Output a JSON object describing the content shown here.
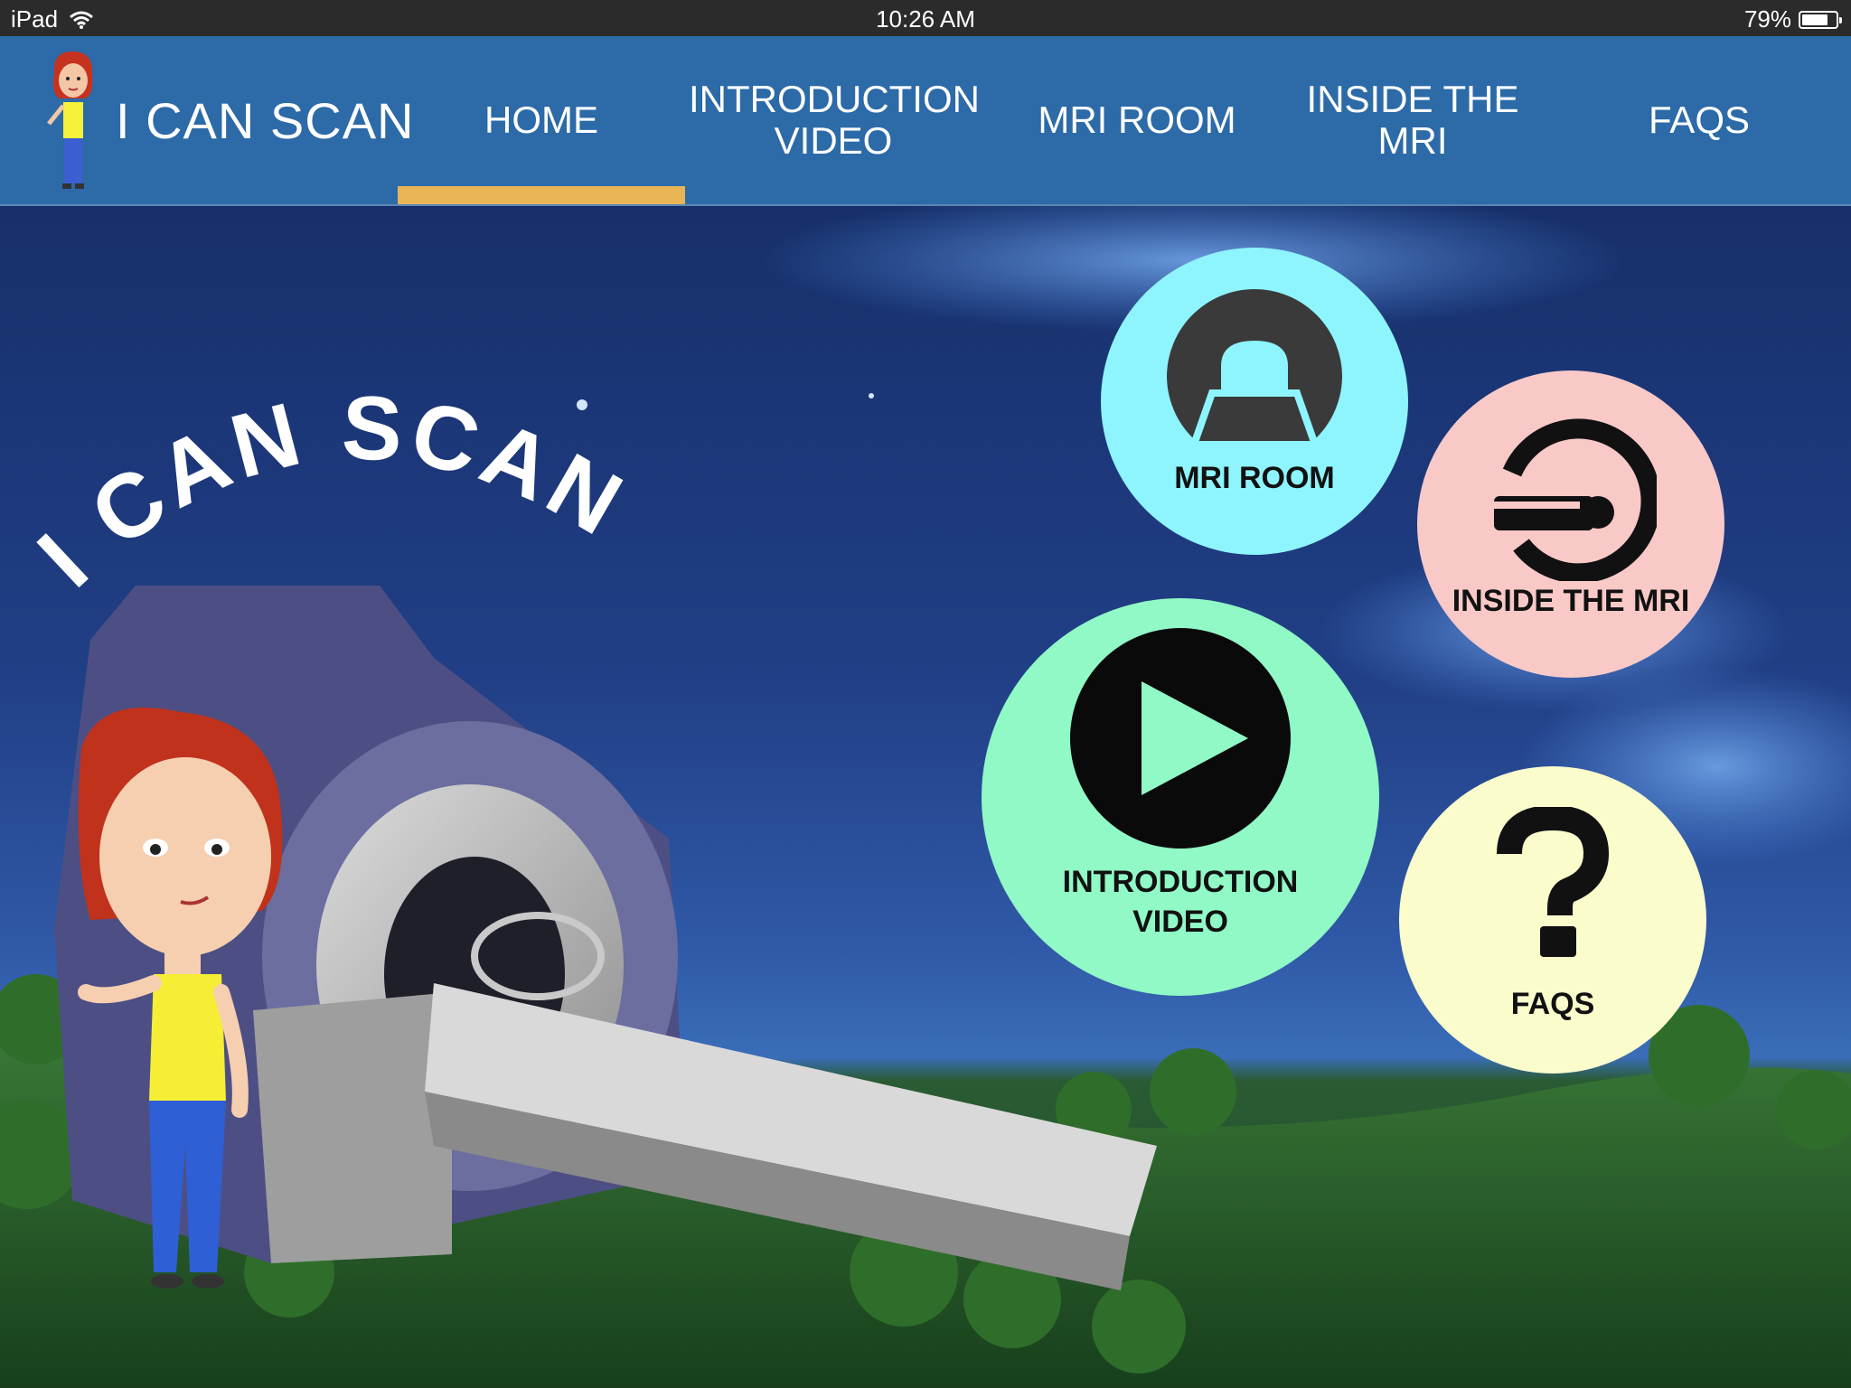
{
  "status_bar": {
    "device": "iPad",
    "time": "10:26 AM",
    "battery": "79%",
    "battery_level": 0.79
  },
  "header": {
    "brand": "I CAN SCAN",
    "nav": [
      {
        "label": "HOME",
        "active": true
      },
      {
        "label": "INTRODUCTION VIDEO"
      },
      {
        "label": "MRI ROOM"
      },
      {
        "label": "INSIDE THE MRI"
      },
      {
        "label": "FAQS"
      }
    ]
  },
  "hero": {
    "arc_title": "I CAN SCAN",
    "buttons": [
      {
        "label": "MRI ROOM",
        "color": "#8ef4fd",
        "icon": "mri-scanner-icon"
      },
      {
        "label": "INSIDE THE MRI",
        "color": "#f9c9c7",
        "icon": "patient-in-scanner-icon"
      },
      {
        "label": "INTRODUCTION VIDEO",
        "color": "#90f9c6",
        "icon": "play-icon"
      },
      {
        "label": "FAQS",
        "color": "#fbfccc",
        "icon": "question-mark-icon"
      }
    ]
  },
  "colors": {
    "nav_bg": "#2c6aa8",
    "underline": "#e8b455",
    "statusbar_bg": "#2b2b2b"
  }
}
